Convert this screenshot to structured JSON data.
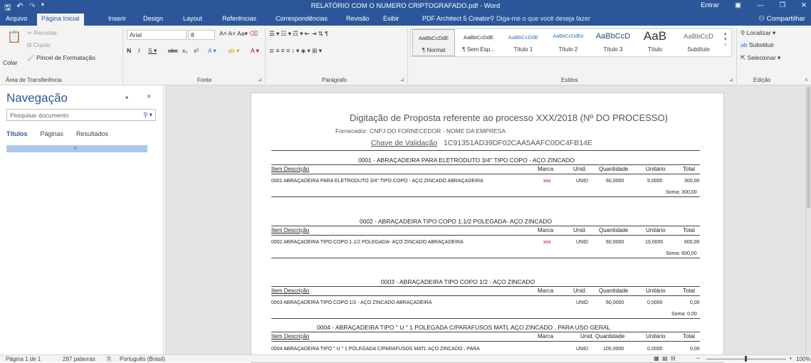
{
  "window": {
    "title": "RELATÓRIO COM O NUMERO CRIPTOGRAFADO.pdf - Word",
    "signin": "Entrar"
  },
  "tabs": [
    "Arquivo",
    "Página Inicial",
    "Inserir",
    "Design",
    "Layout",
    "Referências",
    "Correspondências",
    "Revisão",
    "Exibir",
    "PDF Architect 5 Creator"
  ],
  "tell_me": "Diga-me o que você deseja fazer",
  "share": "Compartilhar",
  "ribbon": {
    "clipboard": {
      "paste": "Colar",
      "cut": "Recortar",
      "copy": "Copiar",
      "format_painter": "Pincel de Formatação",
      "label": "Área de Transferência"
    },
    "font": {
      "name": "Arial",
      "size": "8",
      "label": "Fonte"
    },
    "paragraph": {
      "label": "Parágrafo"
    },
    "styles": {
      "label": "Estilos",
      "items": [
        {
          "preview": "AaBbCcDdE",
          "name": "¶ Normal"
        },
        {
          "preview": "AaBbCcDdE",
          "name": "¶ Sem Esp..."
        },
        {
          "preview": "AaBbCcDdE",
          "name": "Título 1"
        },
        {
          "preview": "AaBbCcDdEe",
          "name": "Título 2"
        },
        {
          "preview": "AaBbCcD",
          "name": "Título 3"
        },
        {
          "preview": "AaB",
          "name": "Título"
        },
        {
          "preview": "AaBbCcD",
          "name": "Subtítulo"
        }
      ]
    },
    "editing": {
      "find": "Localizar",
      "replace": "Substituir",
      "select": "Selecionar",
      "label": "Edição"
    }
  },
  "nav": {
    "title": "Navegação",
    "search_placeholder": "Pesquisar documento",
    "tabs": [
      "Títulos",
      "Páginas",
      "Resultados"
    ]
  },
  "doc": {
    "title": "Digitação de Proposta referente ao processo XXX/2018 (Nº DO PROCESSO)",
    "supplier": "Fornecedor: CNPJ DO FORNECEDOR - NOME DA EMPRESA",
    "key_label": "Chave de Validação",
    "key": "1C91351AD39DF02CAA5AAFC0DC4FB14E",
    "headers": {
      "item": "Item Descrição",
      "marca": "Marca",
      "unid": "Unid.",
      "qtd": "Quantidade",
      "unit": "Unitário",
      "total": "Total"
    },
    "items": [
      {
        "heading": "0001 - ABRAÇADEIRA PARA ELETRODUTO 3/4\" TIPO COPO - AÇO ZINCADO",
        "desc": "0001 ABRAÇADEIRA PARA ELETRODUTO 3/4\" TIPO COPO - AÇO ZINCADO ABRAÇADEIRA",
        "marca": "xxx",
        "unid": "UNID",
        "qtd": "60,0000",
        "unit": "5,0000",
        "total": "300,00",
        "soma": "Soma: 300,00"
      },
      {
        "heading": "0002 - ABRAÇADEIRA TIPO COPO 1.1/2 POLEGADA- AÇO ZINCADO",
        "desc": "0002 ABRAÇADEIRA TIPO COPO 1.1/2 POLEGADA- AÇO ZINCADO ABRAÇADEIRA",
        "marca": "xxx",
        "unid": "UNID",
        "qtd": "60,0000",
        "unit": "10,0000",
        "total": "600,00",
        "soma": "Soma: 600,00"
      },
      {
        "heading": "0003 - ABRAÇADEIRA TIPO COPO 1/2 - AÇO ZINCADO",
        "desc": "0003 ABRAÇADEIRA TIPO COPO 1/2 - AÇO ZINCADO ABRAÇADEIRA",
        "marca": "",
        "unid": "UNID",
        "qtd": "60,0000",
        "unit": "0,0000",
        "total": "0,00",
        "soma": "Soma: 0,00"
      },
      {
        "heading": "0004 - ABRAÇADEIRA TIPO \" U \" 1 POLEGADA C/PARAFUSOS MATL AÇO ZINCADO , PARA USO GERAL",
        "desc": "0004 ABRAÇADEIRA TIPO \" U \" 1 POLEGADA C/PARAFUSOS MATL AÇO ZINCADO , PARA",
        "marca": "",
        "unid": "UNID",
        "qtd": "100,0000",
        "unit": "0,0000",
        "total": "0,00",
        "soma": ""
      }
    ]
  },
  "status": {
    "page": "Página 1 de 1",
    "words": "287 palavras",
    "language": "Português (Brasil)",
    "zoom": "100%"
  }
}
